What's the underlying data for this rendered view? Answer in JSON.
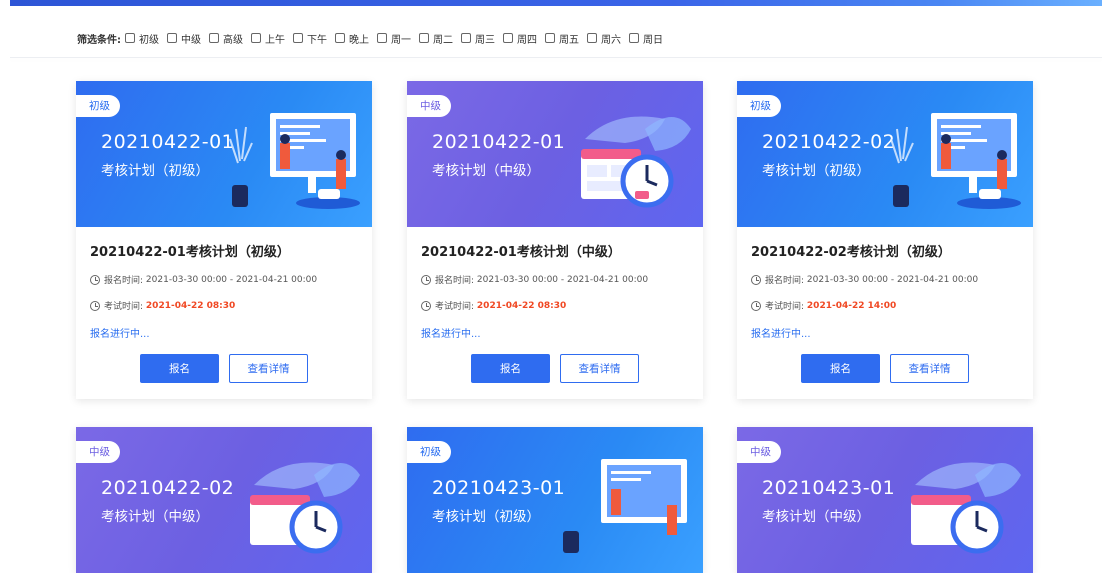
{
  "filter": {
    "label": "筛选条件:",
    "options": [
      "初级",
      "中级",
      "高级",
      "上午",
      "下午",
      "晚上",
      "周一",
      "周二",
      "周三",
      "周四",
      "周五",
      "周六",
      "周日"
    ]
  },
  "cards": [
    {
      "level": "初级",
      "banner_code": "20210422-01",
      "banner_sub": "考核计划（初级）",
      "title": "20210422-01考核计划（初级）",
      "reg_label": "报名时间:",
      "reg_time": "2021-03-30 00:00 - 2021-04-21 00:00",
      "exam_label": "考试时间:",
      "exam_time": "2021-04-22 08:30",
      "status": "报名进行中...",
      "btn_register": "报名",
      "btn_detail": "查看详情",
      "theme": "blue"
    },
    {
      "level": "中级",
      "banner_code": "20210422-01",
      "banner_sub": "考核计划（中级）",
      "title": "20210422-01考核计划（中级）",
      "reg_label": "报名时间:",
      "reg_time": "2021-03-30 00:00 - 2021-04-21 00:00",
      "exam_label": "考试时间:",
      "exam_time": "2021-04-22 08:30",
      "status": "报名进行中...",
      "btn_register": "报名",
      "btn_detail": "查看详情",
      "theme": "purple"
    },
    {
      "level": "初级",
      "banner_code": "20210422-02",
      "banner_sub": "考核计划（初级）",
      "title": "20210422-02考核计划（初级）",
      "reg_label": "报名时间:",
      "reg_time": "2021-03-30 00:00 - 2021-04-21 00:00",
      "exam_label": "考试时间:",
      "exam_time": "2021-04-22 14:00",
      "status": "报名进行中...",
      "btn_register": "报名",
      "btn_detail": "查看详情",
      "theme": "blue"
    },
    {
      "level": "中级",
      "banner_code": "20210422-02",
      "banner_sub": "考核计划（中级）",
      "theme": "purple"
    },
    {
      "level": "初级",
      "banner_code": "20210423-01",
      "banner_sub": "考核计划（初级）",
      "theme": "blue"
    },
    {
      "level": "中级",
      "banner_code": "20210423-01",
      "banner_sub": "考核计划（中级）",
      "theme": "purple"
    }
  ],
  "colors": {
    "primary": "#2f6cf0",
    "accent_red": "#f04823",
    "purple": "#6c5fe2"
  },
  "icons": [
    "clock-icon",
    "checkbox-icon"
  ]
}
